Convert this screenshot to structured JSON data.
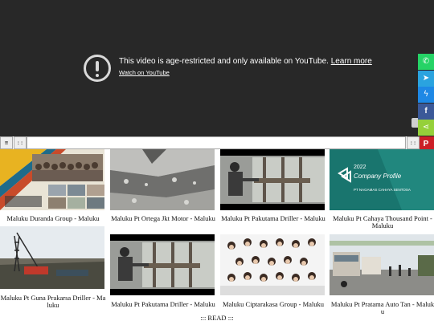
{
  "player": {
    "message": "This video is age-restricted and only available on YouTube.",
    "learn_more": "Learn more",
    "watch_link": "Watch on YouTube"
  },
  "share": [
    {
      "icon": "whatsapp-icon",
      "color": "#25d366",
      "glyph": "✆"
    },
    {
      "icon": "telegram-icon",
      "color": "#2aa3df",
      "glyph": "➤"
    },
    {
      "icon": "messenger-icon",
      "color": "#1e88e5",
      "glyph": "ϟ"
    },
    {
      "icon": "facebook-icon",
      "color": "#3b5998",
      "glyph": "f"
    },
    {
      "icon": "sharethis-icon",
      "color": "#95d03a",
      "glyph": "⋖"
    },
    {
      "icon": "pinterest-icon",
      "color": "#cb2027",
      "glyph": "P"
    },
    {
      "icon": "x-twitter-icon",
      "color": "#1a1a1a",
      "glyph": "✕"
    },
    {
      "icon": "email-icon",
      "color": "#d93f30",
      "glyph": "✉"
    }
  ],
  "toolbar": {
    "menu_label": "≡",
    "dots_label": "::",
    "right_label": "::"
  },
  "videos": [
    {
      "title": "Maluku Duranda Group - Maluku"
    },
    {
      "title": "Maluku Pt Ortega Jkt Motor - Maluku"
    },
    {
      "title": "Maluku Pt Pakutama Driller - Maluku"
    },
    {
      "title": "Maluku Pt Cahaya Thousand Point - Maluku",
      "thumb_text": [
        "2022",
        "Company Profile",
        "PT NAGAMAS CAHAYA SENTOSA"
      ]
    },
    {
      "title": "Maluku Pt Guna Prakarsa Driller - Maluku"
    },
    {
      "title": "Maluku Pt Pakutama Driller - Maluku"
    },
    {
      "title": "Maluku Ciptarakasa Group - Maluku"
    },
    {
      "title": "Maluku Pt Pratama Auto Tan - Maluku"
    }
  ],
  "read_more": "::: READ :::"
}
